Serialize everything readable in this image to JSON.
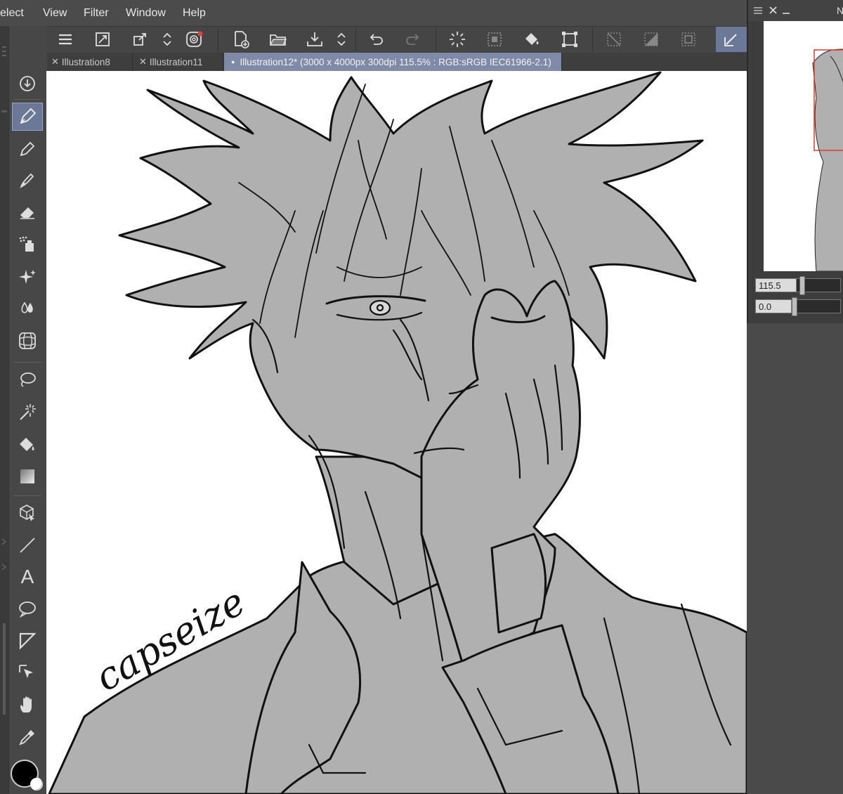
{
  "menubar": {
    "items": [
      "elect",
      "View",
      "Filter",
      "Window",
      "Help"
    ]
  },
  "command_bar": {
    "icons": [
      "menu-icon",
      "fit-canvas-icon",
      "transform-icon",
      "up-down-arrows-icon",
      "spiral-icon",
      "new-file-icon",
      "open-folder-icon",
      "save-icon",
      "up-down-arrows-icon",
      "undo-icon",
      "redo-icon",
      "loading-spinner-icon",
      "select-dotted-icon",
      "fill-bucket-icon",
      "crop-transform-icon",
      "deselect-icon",
      "invert-selection-icon",
      "selection-border-icon",
      "pen-active-icon"
    ]
  },
  "tabs": [
    {
      "label": "Illustration8",
      "active": false
    },
    {
      "label": "Illustration11",
      "active": false
    },
    {
      "label": "Illustration12* (3000 x 4000px 300dpi 115.5% : RGB:sRGB IEC61966-2.1)",
      "active": true
    }
  ],
  "tools": [
    "download-icon",
    "pen-icon",
    "pencil-icon",
    "brush-icon",
    "eraser-icon",
    "spray-icon",
    "sparkle-icon",
    "blend-drops-icon",
    "mesh-icon",
    "lasso-icon",
    "magic-wand-icon",
    "fill-icon",
    "gradient-icon",
    "3d-object-icon",
    "line-icon",
    "text-icon",
    "speech-balloon-icon",
    "frame-border-icon",
    "object-select-icon",
    "hand-icon",
    "eyedropper-icon"
  ],
  "text_tool_glyph": "A",
  "navigator": {
    "title_icons": [
      "panel-menu-icon",
      "close-icon",
      "minimize-icon"
    ],
    "title_cut": "N",
    "zoom_value": "115.5",
    "rotate_value": "0.0"
  },
  "artwork": {
    "signature": "capseize"
  },
  "colors": {
    "accent": "#7f8aa8",
    "active_tool": "#6c7898",
    "nav_viewport": "#e03a2e",
    "panel": "#474747",
    "fill_gray": "#b0b0b0"
  }
}
